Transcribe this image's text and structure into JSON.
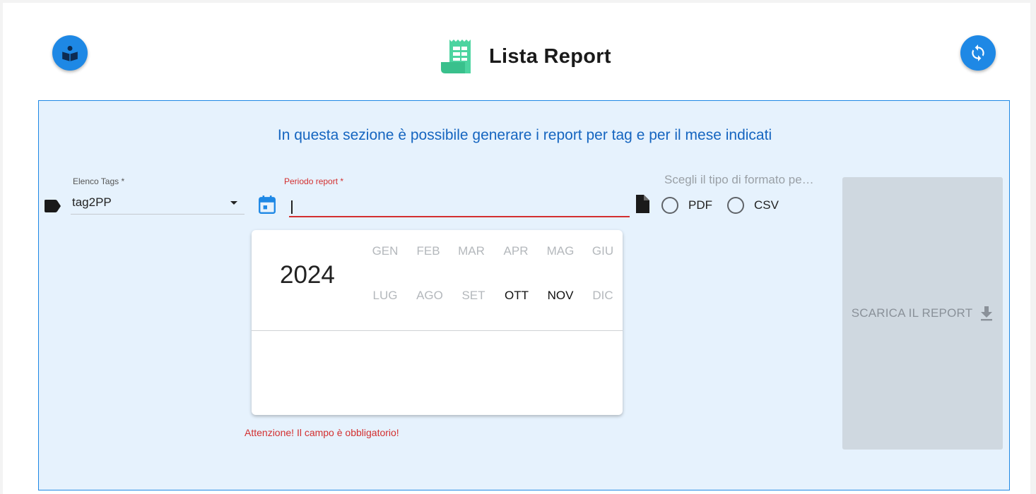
{
  "header": {
    "title": "Lista Report",
    "left_button_icon": "reader-book-icon",
    "right_button_icon": "refresh-icon",
    "title_icon": "report-receipt-icon"
  },
  "panel": {
    "intro": "In questa sezione è possibile generare i report per tag e per il mese indicati",
    "tags": {
      "label": "Elenco Tags *",
      "value": "tag2PP",
      "icon": "tag-icon"
    },
    "period": {
      "label": "Periodo report *",
      "value": "",
      "icon": "calendar-icon",
      "error": "Attenzione! Il campo è obbligatorio!"
    },
    "format": {
      "label": "Scegli il tipo di formato pe…",
      "icon": "file-icon",
      "options": [
        {
          "label": "PDF",
          "selected": false
        },
        {
          "label": "CSV",
          "selected": false
        }
      ]
    },
    "download": {
      "label": "SCARICA IL REPORT",
      "icon": "download-icon",
      "enabled": false
    }
  },
  "month_picker": {
    "year": "2024",
    "months": [
      {
        "label": "GEN",
        "enabled": false
      },
      {
        "label": "FEB",
        "enabled": false
      },
      {
        "label": "MAR",
        "enabled": false
      },
      {
        "label": "APR",
        "enabled": false
      },
      {
        "label": "MAG",
        "enabled": false
      },
      {
        "label": "GIU",
        "enabled": false
      },
      {
        "label": "LUG",
        "enabled": false
      },
      {
        "label": "AGO",
        "enabled": false
      },
      {
        "label": "SET",
        "enabled": false
      },
      {
        "label": "OTT",
        "enabled": true
      },
      {
        "label": "NOV",
        "enabled": true
      },
      {
        "label": "DIC",
        "enabled": false
      }
    ]
  },
  "colors": {
    "accent": "#1e88e5",
    "panel_bg": "#e6f2fd",
    "error": "#d32f2f",
    "title_icon": "#4cd4a0"
  }
}
